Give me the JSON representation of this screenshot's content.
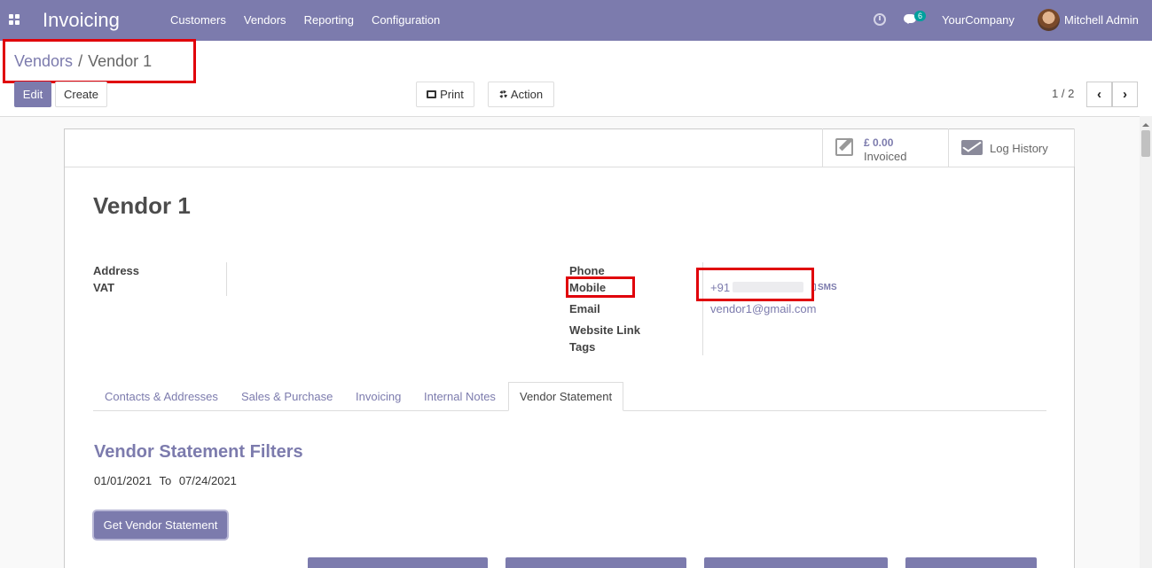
{
  "navbar": {
    "brand": "Invoicing",
    "menu": [
      "Customers",
      "Vendors",
      "Reporting",
      "Configuration"
    ],
    "chat_count": "6",
    "company": "YourCompany",
    "user": "Mitchell Admin"
  },
  "breadcrumb": {
    "parent": "Vendors",
    "separator": "/",
    "current": "Vendor 1"
  },
  "toolbar": {
    "edit_label": "Edit",
    "create_label": "Create",
    "print_label": "Print",
    "action_label": "Action",
    "pager": "1 / 2"
  },
  "smart_buttons": {
    "invoiced_value": "£ 0.00",
    "invoiced_label": "Invoiced",
    "log_label": "Log History"
  },
  "record": {
    "name": "Vendor 1",
    "left_labels": [
      "Address",
      "VAT"
    ],
    "right_labels": [
      "Phone",
      "Mobile",
      "Email",
      "Website Link",
      "Tags"
    ],
    "mobile_prefix": "+91",
    "sms_label": "SMS",
    "email": "vendor1@gmail.com"
  },
  "tabs": [
    "Contacts & Addresses",
    "Sales & Purchase",
    "Invoicing",
    "Internal Notes",
    "Vendor Statement"
  ],
  "active_tab": "Vendor Statement",
  "statement": {
    "title": "Vendor Statement Filters",
    "date_from": "01/01/2021",
    "to_label": "To",
    "date_to": "07/24/2021",
    "get_button": "Get Vendor Statement"
  },
  "colors": {
    "brand": "#7c7bad",
    "highlight": "#e0000a"
  }
}
